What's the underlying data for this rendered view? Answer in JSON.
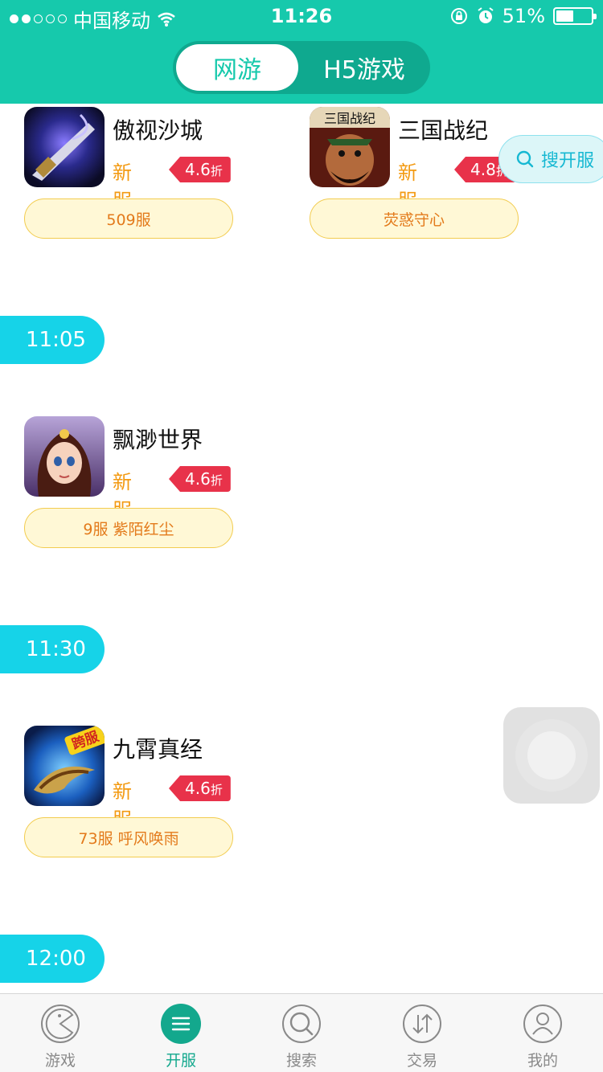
{
  "status_bar": {
    "carrier": "中国移动",
    "time": "11:26",
    "battery": "51%",
    "battery_level": 0.51
  },
  "tabs": {
    "online": "网游",
    "h5": "H5游戏"
  },
  "games": [
    {
      "name": "傲视沙城",
      "tag": "新服",
      "discount": "4.6",
      "discount_unit": "折",
      "server": "509服"
    },
    {
      "name": "三国战纪",
      "tag": "新服",
      "discount": "4.8",
      "discount_unit": "折",
      "server": "荧惑守心",
      "icon_text": "三国战纪"
    },
    {
      "name": "飘渺世界",
      "tag": "新服",
      "discount": "4.6",
      "discount_unit": "折",
      "server": "9服 紫陌红尘"
    },
    {
      "name": "九霄真经",
      "tag": "新服",
      "discount": "4.6",
      "discount_unit": "折",
      "server": "73服 呼风唤雨",
      "icon_badge": "跨服"
    }
  ],
  "times": [
    "11:05",
    "11:30",
    "12:00"
  ],
  "search_float": {
    "label": "搜开服"
  },
  "bottom_nav": [
    "游戏",
    "开服",
    "搜索",
    "交易",
    "我的"
  ],
  "colors": {
    "primary": "#16c9ac",
    "time_pill": "#16d3e8",
    "discount": "#e8324a",
    "new": "#f39a12"
  }
}
